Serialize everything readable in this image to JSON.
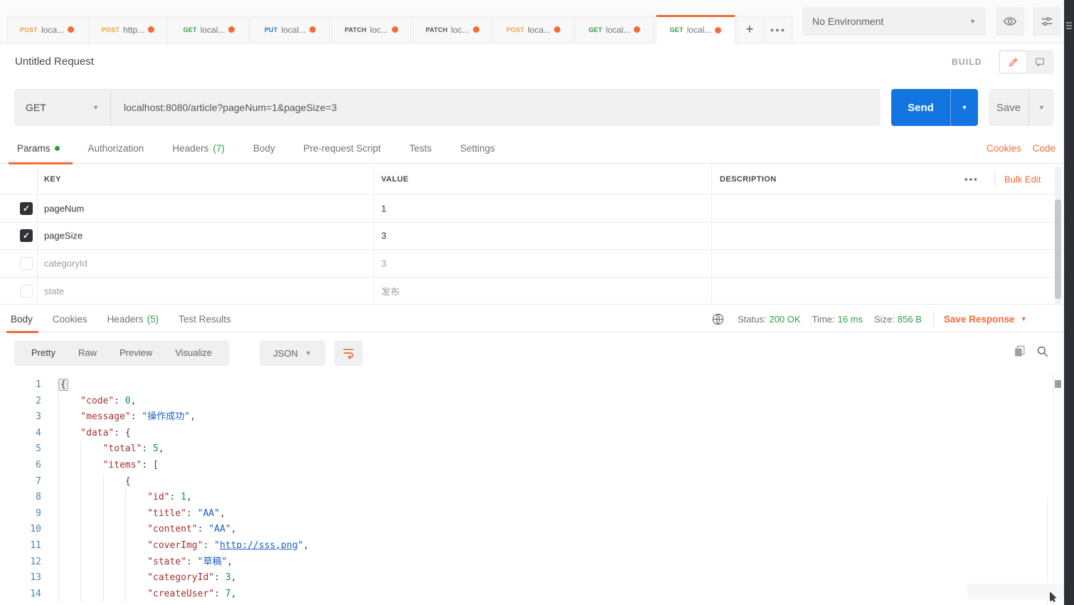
{
  "tabbar": {
    "tabs": [
      {
        "method": "POST",
        "label": "loca...",
        "modified": true,
        "active": false
      },
      {
        "method": "POST",
        "label": "http...",
        "modified": true,
        "active": false
      },
      {
        "method": "GET",
        "label": "local...",
        "modified": true,
        "active": false
      },
      {
        "method": "PUT",
        "label": "local...",
        "modified": true,
        "active": false
      },
      {
        "method": "PATCH",
        "label": "loc...",
        "modified": true,
        "active": false
      },
      {
        "method": "PATCH",
        "label": "loc...",
        "modified": true,
        "active": false
      },
      {
        "method": "POST",
        "label": "loca...",
        "modified": true,
        "active": false
      },
      {
        "method": "GET",
        "label": "local...",
        "modified": true,
        "active": false
      },
      {
        "method": "GET",
        "label": "local...",
        "modified": true,
        "active": true
      }
    ],
    "new_tab_label": "+",
    "more_label": "●●●"
  },
  "environment": {
    "selected": "No Environment"
  },
  "request": {
    "title": "Untitled Request",
    "mode_label": "BUILD",
    "method": "GET",
    "url": "localhost:8080/article?pageNum=1&pageSize=3",
    "send_label": "Send",
    "save_label": "Save",
    "tabs": [
      {
        "label": "Params",
        "dot": true,
        "active": true
      },
      {
        "label": "Authorization"
      },
      {
        "label": "Headers",
        "count": "(7)"
      },
      {
        "label": "Body"
      },
      {
        "label": "Pre-request Script"
      },
      {
        "label": "Tests"
      },
      {
        "label": "Settings"
      }
    ],
    "cookies_link": "Cookies",
    "code_link": "Code"
  },
  "params_table": {
    "columns": {
      "key": "KEY",
      "value": "VALUE",
      "description": "DESCRIPTION"
    },
    "more_label": "•••",
    "bulk_edit": "Bulk Edit",
    "rows": [
      {
        "checked": true,
        "key": "pageNum",
        "value": "1",
        "description": ""
      },
      {
        "checked": true,
        "key": "pageSize",
        "value": "3",
        "description": ""
      },
      {
        "checked": false,
        "key": "categoryId",
        "value": "3",
        "description": ""
      },
      {
        "checked": false,
        "key": "state",
        "value": "发布",
        "description": ""
      }
    ]
  },
  "response": {
    "tabs": [
      {
        "label": "Body",
        "active": true
      },
      {
        "label": "Cookies"
      },
      {
        "label": "Headers",
        "count": "(5)"
      },
      {
        "label": "Test Results"
      }
    ],
    "status_label": "Status:",
    "status": "200 OK",
    "time_label": "Time:",
    "time": "16 ms",
    "size_label": "Size:",
    "size": "856 B",
    "save_response": "Save Response",
    "views": [
      "Pretty",
      "Raw",
      "Preview",
      "Visualize"
    ],
    "view_active": "Pretty",
    "format": "JSON"
  },
  "code": {
    "lines": [
      {
        "n": 1,
        "indent": 0,
        "t": [
          [
            "hl",
            "{"
          ]
        ]
      },
      {
        "n": 2,
        "indent": 1,
        "t": [
          [
            "k",
            "\"code\""
          ],
          [
            "p",
            ": "
          ],
          [
            "n",
            "0"
          ],
          [
            "p",
            ","
          ]
        ]
      },
      {
        "n": 3,
        "indent": 1,
        "t": [
          [
            "k",
            "\"message\""
          ],
          [
            "p",
            ": "
          ],
          [
            "s",
            "\"操作成功\""
          ],
          [
            "p",
            ","
          ]
        ]
      },
      {
        "n": 4,
        "indent": 1,
        "t": [
          [
            "k",
            "\"data\""
          ],
          [
            "p",
            ": {"
          ]
        ]
      },
      {
        "n": 5,
        "indent": 2,
        "t": [
          [
            "k",
            "\"total\""
          ],
          [
            "p",
            ": "
          ],
          [
            "n",
            "5"
          ],
          [
            "p",
            ","
          ]
        ]
      },
      {
        "n": 6,
        "indent": 2,
        "t": [
          [
            "k",
            "\"items\""
          ],
          [
            "p",
            ": ["
          ]
        ]
      },
      {
        "n": 7,
        "indent": 3,
        "t": [
          [
            "p",
            "{"
          ]
        ]
      },
      {
        "n": 8,
        "indent": 4,
        "t": [
          [
            "k",
            "\"id\""
          ],
          [
            "p",
            ": "
          ],
          [
            "n",
            "1"
          ],
          [
            "p",
            ","
          ]
        ]
      },
      {
        "n": 9,
        "indent": 4,
        "t": [
          [
            "k",
            "\"title\""
          ],
          [
            "p",
            ": "
          ],
          [
            "s",
            "\"AA\""
          ],
          [
            "p",
            ","
          ]
        ]
      },
      {
        "n": 10,
        "indent": 4,
        "t": [
          [
            "k",
            "\"content\""
          ],
          [
            "p",
            ": "
          ],
          [
            "s",
            "\"AA\""
          ],
          [
            "p",
            ","
          ]
        ]
      },
      {
        "n": 11,
        "indent": 4,
        "t": [
          [
            "k",
            "\"coverImg\""
          ],
          [
            "p",
            ": "
          ],
          [
            "s",
            "\""
          ],
          [
            "link",
            "http://sss,png"
          ],
          [
            "s",
            "\""
          ],
          [
            "p",
            ","
          ]
        ]
      },
      {
        "n": 12,
        "indent": 4,
        "t": [
          [
            "k",
            "\"state\""
          ],
          [
            "p",
            ": "
          ],
          [
            "s",
            "\"草稿\""
          ],
          [
            "p",
            ","
          ]
        ]
      },
      {
        "n": 13,
        "indent": 4,
        "t": [
          [
            "k",
            "\"categoryId\""
          ],
          [
            "p",
            ": "
          ],
          [
            "n",
            "3"
          ],
          [
            "p",
            ","
          ]
        ]
      },
      {
        "n": 14,
        "indent": 4,
        "t": [
          [
            "k",
            "\"createUser\""
          ],
          [
            "p",
            ": "
          ],
          [
            "n",
            "7"
          ],
          [
            "p",
            ","
          ]
        ]
      }
    ]
  },
  "colors": {
    "accent_orange": "#f26b3a",
    "send_blue": "#1375e0",
    "status_green": "#2f9e44",
    "method_post": "#e8a33d",
    "method_get": "#2f9e44",
    "method_put": "#147cd4",
    "method_patch": "#4f545a",
    "json_key": "#a33131",
    "json_string": "#1a5cc8",
    "json_number": "#0d9153",
    "line_number": "#4a85ad"
  }
}
